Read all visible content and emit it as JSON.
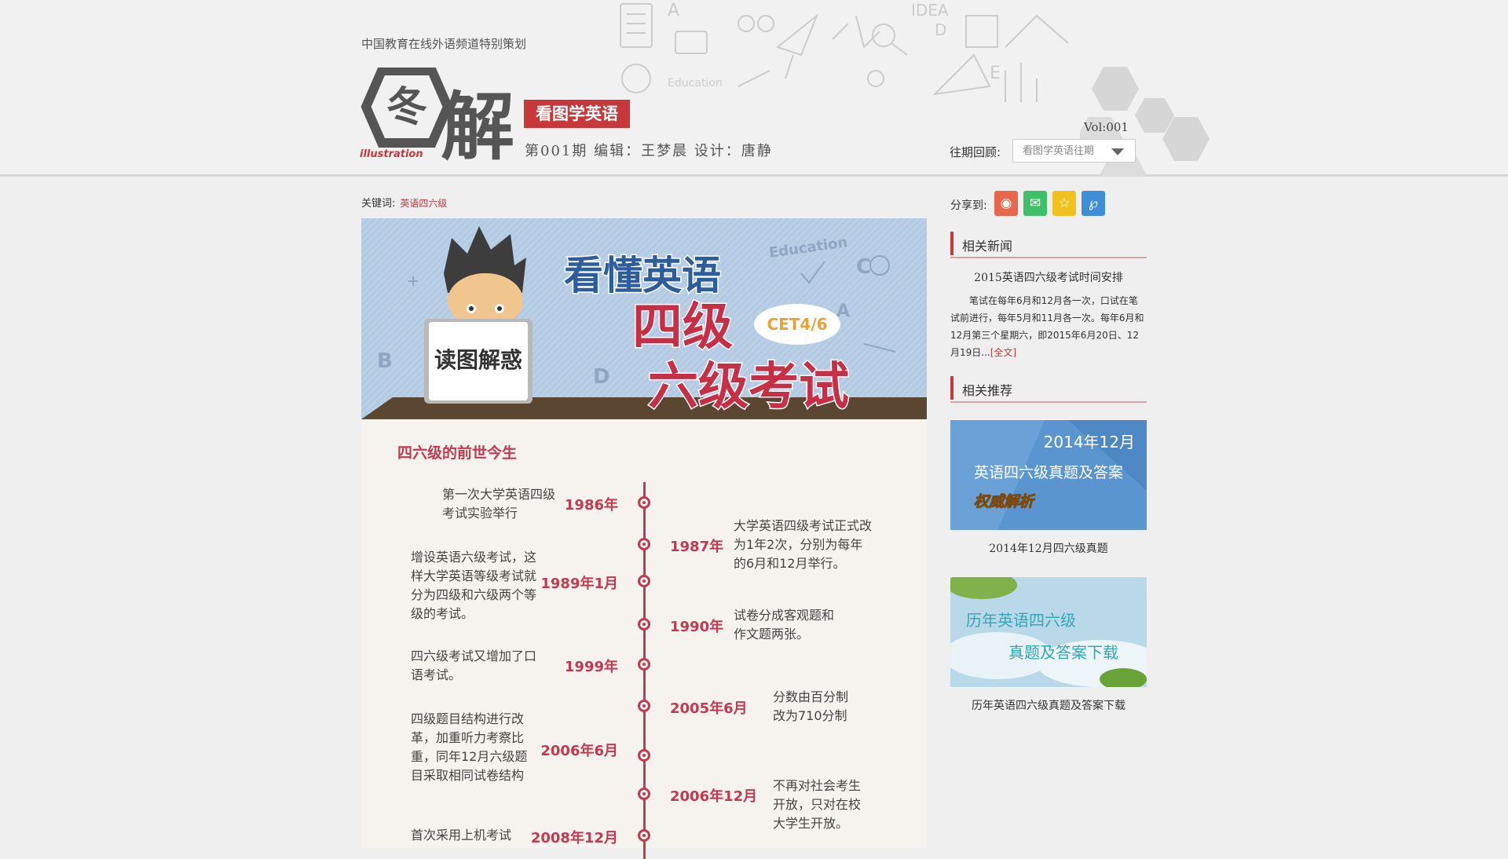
{
  "header": {
    "tagline": "中国教育在线外语频道特别策划",
    "logo_main": "图解",
    "logo_sub": "illustration",
    "section_badge": "看图学英语",
    "credits": "第001期  编辑：王梦晨  设计：唐静",
    "volume": "Vol:001",
    "past_issues_label": "往期回顾:",
    "past_issues_select": "看图学英语往期"
  },
  "keywords": {
    "label": "关键词:",
    "value": "英语四六级"
  },
  "banner": {
    "sign_text": "读图解惑",
    "headline_1": "看懂英语",
    "headline_2": "四级",
    "headline_3": "六级考试",
    "cet_badge": "CET4/6",
    "doodle_word": "Education",
    "doodle_letters": [
      "B",
      "D",
      "C",
      "A"
    ]
  },
  "timeline": {
    "title": "四六级的前世今生",
    "events": [
      {
        "year": "1986年",
        "text": "第一次大学英语四级考试实验举行",
        "side": "left"
      },
      {
        "year": "1987年",
        "text": "大学英语四级考试正式改为1年2次，分别为每年的6月和12月举行。",
        "side": "right"
      },
      {
        "year": "1989年1月",
        "text": "增设英语六级考试，这样大学英语等级考试就分为四级和六级两个等级的考试。",
        "side": "left"
      },
      {
        "year": "1990年",
        "text": "试卷分成客观题和作文题两张。",
        "side": "right"
      },
      {
        "year": "1999年",
        "text": "四六级考试又增加了口语考试。",
        "side": "left"
      },
      {
        "year": "2005年6月",
        "text": "分数由百分制改为710分制",
        "side": "right"
      },
      {
        "year": "2006年6月",
        "text": "四级题目结构进行改革，加重听力考察比重，同年12月六级题目采取相同试卷结构",
        "side": "left"
      },
      {
        "year": "2006年12月",
        "text": "不再对社会考生开放，只对在校大学生开放。",
        "side": "right"
      },
      {
        "year": "2008年12月",
        "text": "首次采用上机考试",
        "side": "left"
      }
    ]
  },
  "sidebar": {
    "share_label": "分享到:",
    "share_buttons": [
      {
        "icon": "weibo-icon",
        "color": "#e8674c"
      },
      {
        "icon": "wechat-icon",
        "color": "#3fbf6a"
      },
      {
        "icon": "qzone-star-icon",
        "color": "#f1c21e"
      },
      {
        "icon": "tencent-weibo-icon",
        "color": "#3f8fd8"
      }
    ],
    "related_news": {
      "heading": "相关新闻",
      "title": "2015英语四六级考试时间安排",
      "body": "笔试在每年6月和12月各一次，口试在笔试前进行，每年5月和11月各一次。每年6月和12月第三个星期六，即2015年6月20日、12月19日...",
      "more": "[全文]"
    },
    "related_recommend": {
      "heading": "相关推荐",
      "items": [
        {
          "img_line1": "2014年12月",
          "img_line2": "英语四六级真题及答案",
          "img_line3": "权威解析",
          "caption": "2014年12月四六级真题"
        },
        {
          "img_line1": "历年英语四六级",
          "img_line2": "真题及答案下载",
          "caption": "历年英语四六级真题及答案下载"
        }
      ]
    }
  },
  "colors": {
    "accent_red": "#c8383b",
    "timeline_red": "#c23a52",
    "banner_blue": "#b8cfe6"
  }
}
